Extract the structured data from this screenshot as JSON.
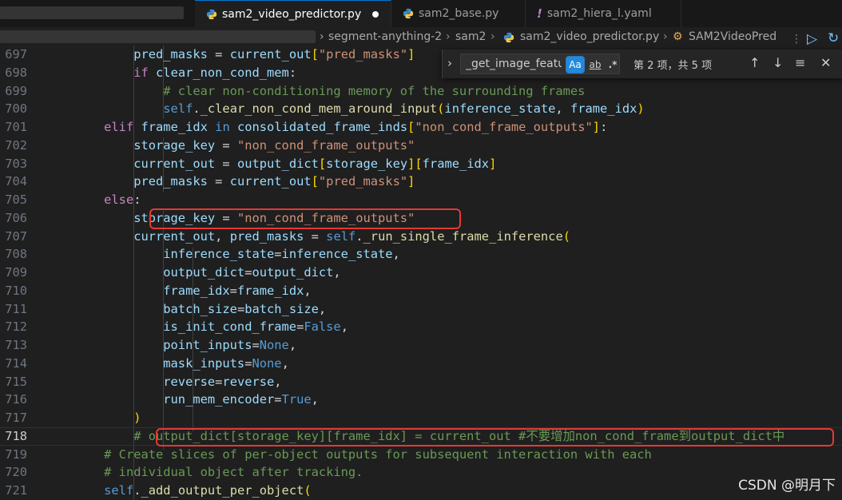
{
  "tabs": [
    {
      "label": "sam2_video_predictor.py",
      "icon": "python-icon",
      "active": true,
      "modified": true
    },
    {
      "label": "sam2_base.py",
      "icon": "python-icon",
      "active": false,
      "modified": false
    },
    {
      "label": "sam2_hiera_l.yaml",
      "icon": "exclamation-icon",
      "active": false,
      "modified": false
    }
  ],
  "breadcrumb": [
    "segment-anything-2",
    "sam2",
    "sam2_video_predictor.py",
    "SAM2VideoPred"
  ],
  "find": {
    "value": "_get_image_featur",
    "match_case_label": "Aa",
    "whole_word_label": "ab",
    "regex_label": ".*",
    "count_text": "第 2 项，共 5 项"
  },
  "code_lines": [
    {
      "n": "697",
      "segs": [
        [
          "            ",
          "p"
        ],
        [
          "pred_masks",
          "v"
        ],
        [
          " = ",
          "p"
        ],
        [
          "current_out",
          "v"
        ],
        [
          "[",
          "b"
        ],
        [
          "\"pred_masks\"",
          "s"
        ],
        [
          "]",
          "b"
        ]
      ]
    },
    {
      "n": "698",
      "segs": [
        [
          "            ",
          "p"
        ],
        [
          "if",
          "k"
        ],
        [
          " ",
          "p"
        ],
        [
          "clear_non_cond_mem",
          "v"
        ],
        [
          ":",
          "p"
        ]
      ]
    },
    {
      "n": "699",
      "segs": [
        [
          "                ",
          "p"
        ],
        [
          "# clear non-conditioning memory of the surrounding frames",
          "c"
        ]
      ]
    },
    {
      "n": "700",
      "segs": [
        [
          "                ",
          "p"
        ],
        [
          "self",
          "kb"
        ],
        [
          ".",
          "p"
        ],
        [
          "_clear_non_cond_mem_around_input",
          "f"
        ],
        [
          "(",
          "b"
        ],
        [
          "inference_state",
          "v"
        ],
        [
          ", ",
          "p"
        ],
        [
          "frame_idx",
          "v"
        ],
        [
          ")",
          "b"
        ]
      ]
    },
    {
      "n": "701",
      "segs": [
        [
          "        ",
          "p"
        ],
        [
          "elif",
          "k"
        ],
        [
          " ",
          "p"
        ],
        [
          "frame_idx",
          "v"
        ],
        [
          " in ",
          "kb"
        ],
        [
          "consolidated_frame_inds",
          "v"
        ],
        [
          "[",
          "b"
        ],
        [
          "\"non_cond_frame_outputs\"",
          "s"
        ],
        [
          "]",
          "b"
        ],
        [
          ":",
          "p"
        ]
      ]
    },
    {
      "n": "702",
      "segs": [
        [
          "            ",
          "p"
        ],
        [
          "storage_key",
          "v"
        ],
        [
          " = ",
          "p"
        ],
        [
          "\"non_cond_frame_outputs\"",
          "s"
        ]
      ]
    },
    {
      "n": "703",
      "segs": [
        [
          "            ",
          "p"
        ],
        [
          "current_out",
          "v"
        ],
        [
          " = ",
          "p"
        ],
        [
          "output_dict",
          "v"
        ],
        [
          "[",
          "b"
        ],
        [
          "storage_key",
          "v"
        ],
        [
          "][",
          "b"
        ],
        [
          "frame_idx",
          "v"
        ],
        [
          "]",
          "b"
        ]
      ]
    },
    {
      "n": "704",
      "segs": [
        [
          "            ",
          "p"
        ],
        [
          "pred_masks",
          "v"
        ],
        [
          " = ",
          "p"
        ],
        [
          "current_out",
          "v"
        ],
        [
          "[",
          "b"
        ],
        [
          "\"pred_masks\"",
          "s"
        ],
        [
          "]",
          "b"
        ]
      ]
    },
    {
      "n": "705",
      "segs": [
        [
          "        ",
          "p"
        ],
        [
          "else",
          "k"
        ],
        [
          ":",
          "p"
        ]
      ]
    },
    {
      "n": "706",
      "segs": [
        [
          "            ",
          "p"
        ],
        [
          "storage_key",
          "v"
        ],
        [
          " = ",
          "p"
        ],
        [
          "\"non_cond_frame_outputs\"",
          "s"
        ]
      ]
    },
    {
      "n": "707",
      "segs": [
        [
          "            ",
          "p"
        ],
        [
          "current_out",
          "v"
        ],
        [
          ", ",
          "p"
        ],
        [
          "pred_masks",
          "v"
        ],
        [
          " = ",
          "p"
        ],
        [
          "self",
          "kb"
        ],
        [
          ".",
          "p"
        ],
        [
          "_run_single_frame_inference",
          "f"
        ],
        [
          "(",
          "b"
        ]
      ]
    },
    {
      "n": "708",
      "segs": [
        [
          "                ",
          "p"
        ],
        [
          "inference_state",
          "v"
        ],
        [
          "=",
          "p"
        ],
        [
          "inference_state",
          "v"
        ],
        [
          ",",
          "p"
        ]
      ]
    },
    {
      "n": "709",
      "segs": [
        [
          "                ",
          "p"
        ],
        [
          "output_dict",
          "v"
        ],
        [
          "=",
          "p"
        ],
        [
          "output_dict",
          "v"
        ],
        [
          ",",
          "p"
        ]
      ]
    },
    {
      "n": "710",
      "segs": [
        [
          "                ",
          "p"
        ],
        [
          "frame_idx",
          "v"
        ],
        [
          "=",
          "p"
        ],
        [
          "frame_idx",
          "v"
        ],
        [
          ",",
          "p"
        ]
      ]
    },
    {
      "n": "711",
      "segs": [
        [
          "                ",
          "p"
        ],
        [
          "batch_size",
          "v"
        ],
        [
          "=",
          "p"
        ],
        [
          "batch_size",
          "v"
        ],
        [
          ",",
          "p"
        ]
      ]
    },
    {
      "n": "712",
      "segs": [
        [
          "                ",
          "p"
        ],
        [
          "is_init_cond_frame",
          "v"
        ],
        [
          "=",
          "p"
        ],
        [
          "False",
          "kb"
        ],
        [
          ",",
          "p"
        ]
      ]
    },
    {
      "n": "713",
      "segs": [
        [
          "                ",
          "p"
        ],
        [
          "point_inputs",
          "v"
        ],
        [
          "=",
          "p"
        ],
        [
          "None",
          "kb"
        ],
        [
          ",",
          "p"
        ]
      ]
    },
    {
      "n": "714",
      "segs": [
        [
          "                ",
          "p"
        ],
        [
          "mask_inputs",
          "v"
        ],
        [
          "=",
          "p"
        ],
        [
          "None",
          "kb"
        ],
        [
          ",",
          "p"
        ]
      ]
    },
    {
      "n": "715",
      "segs": [
        [
          "                ",
          "p"
        ],
        [
          "reverse",
          "v"
        ],
        [
          "=",
          "p"
        ],
        [
          "reverse",
          "v"
        ],
        [
          ",",
          "p"
        ]
      ]
    },
    {
      "n": "716",
      "segs": [
        [
          "                ",
          "p"
        ],
        [
          "run_mem_encoder",
          "v"
        ],
        [
          "=",
          "p"
        ],
        [
          "True",
          "kb"
        ],
        [
          ",",
          "p"
        ]
      ]
    },
    {
      "n": "717",
      "segs": [
        [
          "            ",
          "p"
        ],
        [
          ")",
          "b"
        ]
      ]
    },
    {
      "n": "718",
      "segs": [
        [
          "            ",
          "p"
        ],
        [
          "# output_dict[storage_key][frame_idx] = current_out #不要增加non_cond_frame到output_dict中",
          "c"
        ]
      ]
    },
    {
      "n": "719",
      "segs": [
        [
          "        ",
          "p"
        ],
        [
          "# Create slices of per-object outputs for subsequent interaction with each",
          "c"
        ]
      ]
    },
    {
      "n": "720",
      "segs": [
        [
          "        ",
          "p"
        ],
        [
          "# individual object after tracking.",
          "c"
        ]
      ]
    },
    {
      "n": "721",
      "segs": [
        [
          "        ",
          "p"
        ],
        [
          "self",
          "kb"
        ],
        [
          ".",
          "p"
        ],
        [
          "_add_output_per_object",
          "f"
        ],
        [
          "(",
          "b"
        ]
      ]
    }
  ],
  "current_line": "718",
  "watermark": "CSDN @明月下",
  "colors": {
    "highlight_box": "#e53935",
    "accent": "#0078d4"
  }
}
